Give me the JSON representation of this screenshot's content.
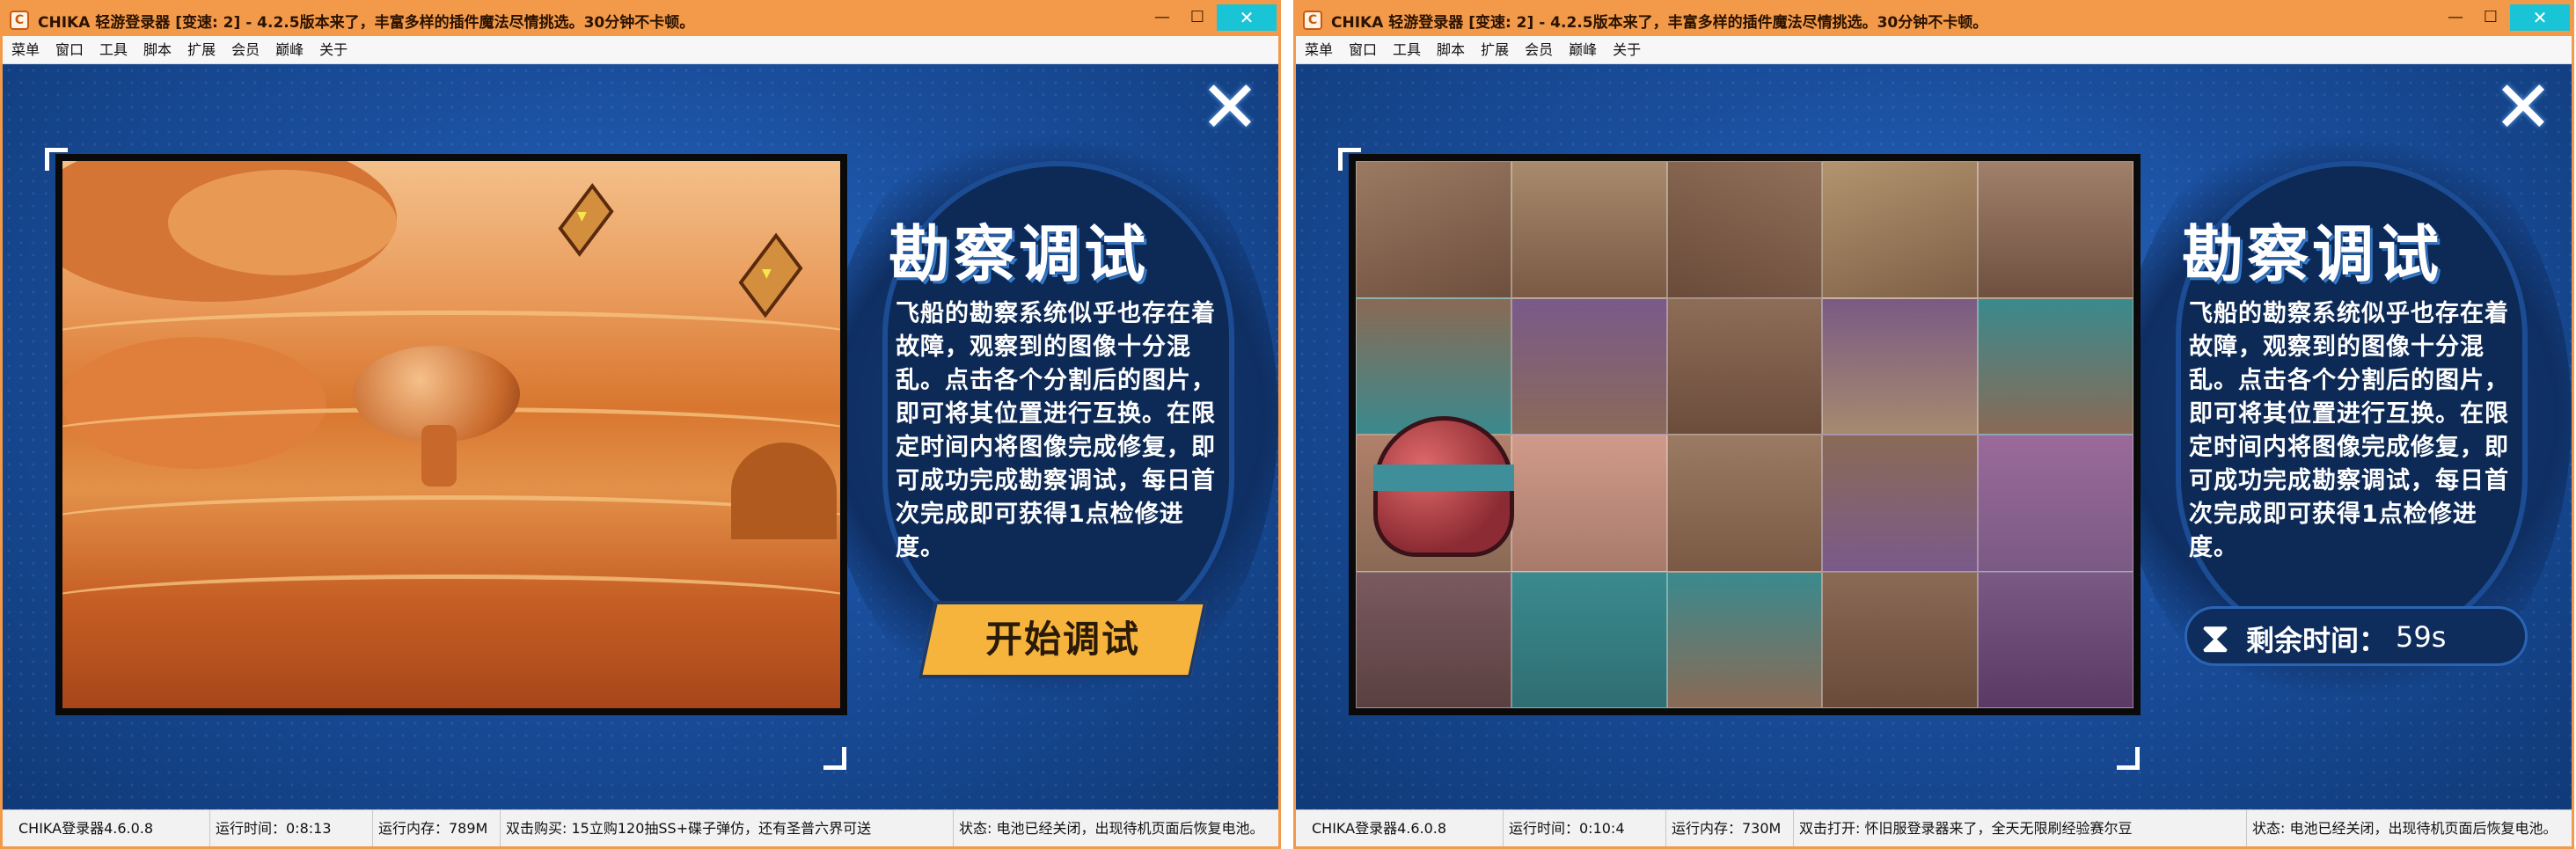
{
  "windows": [
    {
      "title": "CHIKA 轻游登录器 [变速: 2] - 4.2.5版本来了，丰富多样的插件魔法尽情挑选。30分钟不卡顿。",
      "menu": [
        "菜单",
        "窗口",
        "工具",
        "脚本",
        "扩展",
        "会员",
        "巅峰",
        "关于"
      ],
      "panel": {
        "title": "勘察调试",
        "text": "飞船的勘察系统似乎也存在着故障，观察到的图像十分混乱。点击各个分割后的图片，即可将其位置进行互换。在限定时间内将图像完成修复，即可成功完成勘察调试，每日首次完成即可获得1点检修进度。",
        "button": "开始调试"
      },
      "status": {
        "version": "CHIKA登录器4.6.0.8",
        "runtime": "运行时间：0:8:13",
        "memory": "运行内存：789M",
        "message": "双击购买: 15立购120抽SS+碟子弹仿，还有圣普六界可送",
        "state": "状态: 电池已经关闭，出现待机页面后恢复电池。"
      }
    },
    {
      "title": "CHIKA 轻游登录器 [变速: 2] - 4.2.5版本来了，丰富多样的插件魔法尽情挑选。30分钟不卡顿。",
      "menu": [
        "菜单",
        "窗口",
        "工具",
        "脚本",
        "扩展",
        "会员",
        "巅峰",
        "关于"
      ],
      "panel": {
        "title": "勘察调试",
        "text": "飞船的勘察系统似乎也存在着故障，观察到的图像十分混乱。点击各个分割后的图片，即可将其位置进行互换。在限定时间内将图像完成修复，即可成功完成勘察调试，每日首次完成即可获得1点检修进度。",
        "timer_label": "剩余时间：",
        "timer_value": "59s"
      },
      "status": {
        "version": "CHIKA登录器4.6.0.8",
        "runtime": "运行时间：0:10:4",
        "memory": "运行内存：730M",
        "message": "双击打开: 怀旧服登录器来了，全天无限刷经验赛尔豆",
        "state": "状态: 电池已经关闭，出现待机页面后恢复电池。"
      }
    }
  ],
  "icons": {
    "close_x": "close-icon",
    "hourglass": "hourglass-icon",
    "app": "app-icon"
  },
  "colors": {
    "title_bar": "#f39a4a",
    "game_bg": "#1a4f9e",
    "button": "#f7b43c",
    "close_btn": "#19c4d6"
  },
  "window_buttons": {
    "minimize": "—",
    "maximize": "☐",
    "close": "✕"
  }
}
